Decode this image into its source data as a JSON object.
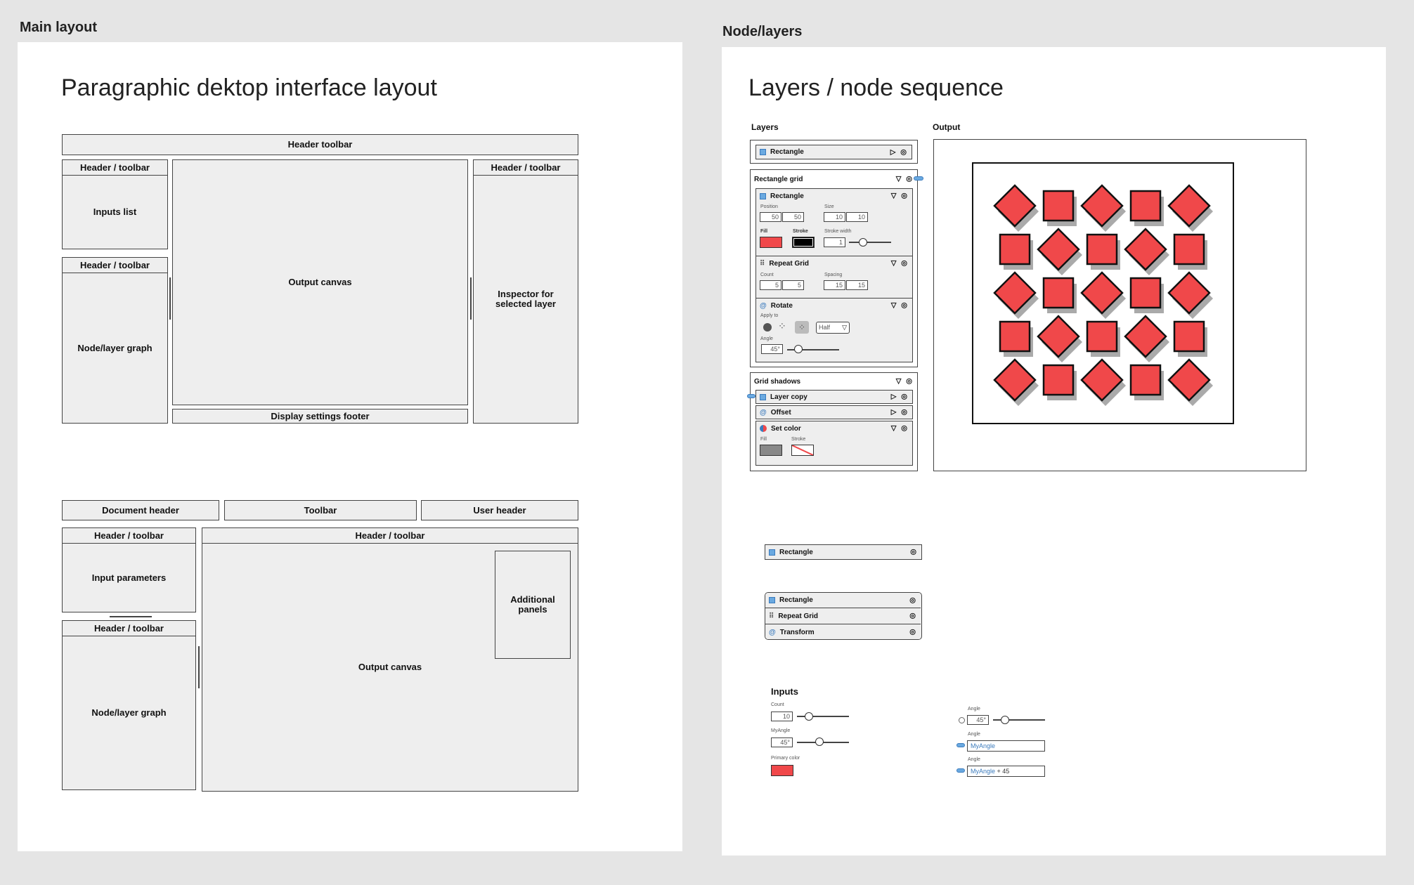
{
  "frames": {
    "left_title": "Main layout",
    "right_title": "Node/layers"
  },
  "layout1": {
    "title": "Paragraphic dektop interface layout",
    "header_toolbar": "Header toolbar",
    "left_top_header": "Header / toolbar",
    "inputs_list": "Inputs list",
    "left_bottom_header": "Header / toolbar",
    "node_graph": "Node/layer graph",
    "output_canvas": "Output canvas",
    "display_footer": "Display settings footer",
    "right_header": "Header / toolbar",
    "inspector": "Inspector for selected layer"
  },
  "layout2": {
    "document_header": "Document header",
    "toolbar": "Toolbar",
    "user_header": "User header",
    "left_top_header": "Header / toolbar",
    "input_parameters": "Input parameters",
    "left_bottom_header": "Header / toolbar",
    "node_graph": "Node/layer graph",
    "main_header": "Header / toolbar",
    "output_canvas": "Output canvas",
    "additional_panels": "Additional panels"
  },
  "layers": {
    "title": "Layers / node sequence",
    "layers_label": "Layers",
    "output_label": "Output",
    "rect_layer": "Rectangle",
    "grid_group": "Rectangle grid",
    "grid_rect": "Rectangle",
    "position_label": "Position",
    "position_x": "50",
    "position_y": "50",
    "size_label": "Size",
    "size_w": "10",
    "size_h": "10",
    "fill_label": "Fill",
    "stroke_label": "Stroke",
    "stroke_width_label": "Stroke width",
    "stroke_width": "1",
    "repeat_grid": "Repeat Grid",
    "count_label": "Count",
    "count_x": "5",
    "count_y": "5",
    "spacing_label": "Spacing",
    "spacing_x": "15",
    "spacing_y": "15",
    "rotate": "Rotate",
    "apply_to_label": "Apply to",
    "apply_select": "Half",
    "angle_label": "Angle",
    "angle_value": "45°",
    "shadows_group": "Grid shadows",
    "layer_copy": "Layer copy",
    "offset": "Offset",
    "set_color": "Set color",
    "sc_fill_label": "Fill",
    "sc_stroke_label": "Stroke",
    "fill_color": "#f0484a",
    "shadow_color": "#aaaaaa"
  },
  "mini": {
    "single_rect": "Rectangle",
    "stack_rect": "Rectangle",
    "stack_grid": "Repeat Grid",
    "stack_transform": "Transform"
  },
  "inputs": {
    "title": "Inputs",
    "count_label": "Count",
    "count_value": "10",
    "myangle_label": "MyAngle",
    "myangle_value": "45°",
    "primary_color_label": "Primary color",
    "angle1_label": "Angle",
    "angle1_value": "45°",
    "angle2_label": "Angle",
    "angle2_value": "MyAngle",
    "angle3_label": "Angle",
    "angle3_var": "MyAngle",
    "angle3_rest": " + 45"
  },
  "output_chart": {
    "rows": 5,
    "cols": 5,
    "pattern": [
      [
        "diamond",
        "square",
        "diamond",
        "square",
        "diamond"
      ],
      [
        "square",
        "diamond",
        "square",
        "diamond",
        "square"
      ],
      [
        "diamond",
        "square",
        "diamond",
        "square",
        "diamond"
      ],
      [
        "square",
        "diamond",
        "square",
        "diamond",
        "square"
      ],
      [
        "diamond",
        "square",
        "diamond",
        "square",
        "diamond"
      ]
    ]
  }
}
